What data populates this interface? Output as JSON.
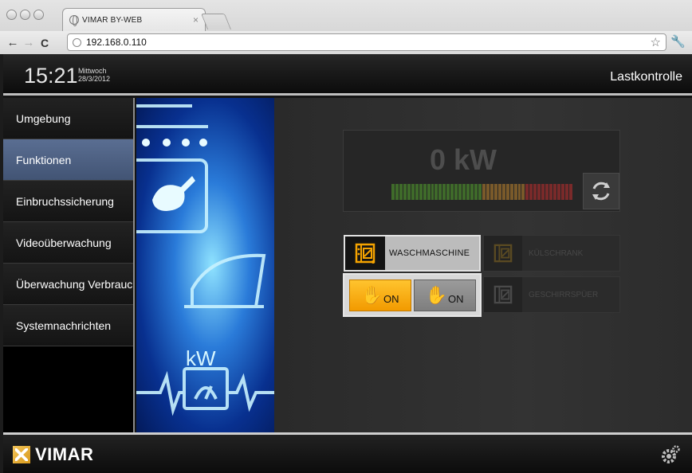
{
  "browser": {
    "tab_title": "VIMAR BY-WEB",
    "tab_close": "×",
    "url": "192.168.0.110",
    "back": "←",
    "forward": "→",
    "reload": "C",
    "star": "☆",
    "wrench": "🔧"
  },
  "header": {
    "time": "15:21",
    "weekday": "Mittwoch",
    "date": "28/3/2012",
    "title": "Lastkontrolle"
  },
  "sidebar": {
    "items": [
      {
        "label": "Umgebung",
        "active": false
      },
      {
        "label": "Funktionen",
        "active": true
      },
      {
        "label": "Einbruchssicherung",
        "active": false
      },
      {
        "label": "Videoüberwachung",
        "active": false
      },
      {
        "label": "Überwachung Verbrauch",
        "active": false
      },
      {
        "label": "Systemnachrichten",
        "active": false
      }
    ]
  },
  "art": {
    "kw_label": "kW"
  },
  "meter": {
    "value": "0 kW",
    "bar_fill": 0
  },
  "devices": {
    "washing": {
      "label": "WASCHMASCHINE",
      "selected": true
    },
    "fridge": {
      "label": "KÜLSCHRANK",
      "selected": false
    },
    "dishwasher": {
      "label": "GESCHIRRSPÜER",
      "selected": false
    }
  },
  "on_panel": {
    "on_active": "ON",
    "on_inactive": "ON"
  },
  "footer": {
    "brand": "VIMAR"
  },
  "colors": {
    "accent_orange": "#f5a300",
    "nav_active": "#4b5f82"
  }
}
